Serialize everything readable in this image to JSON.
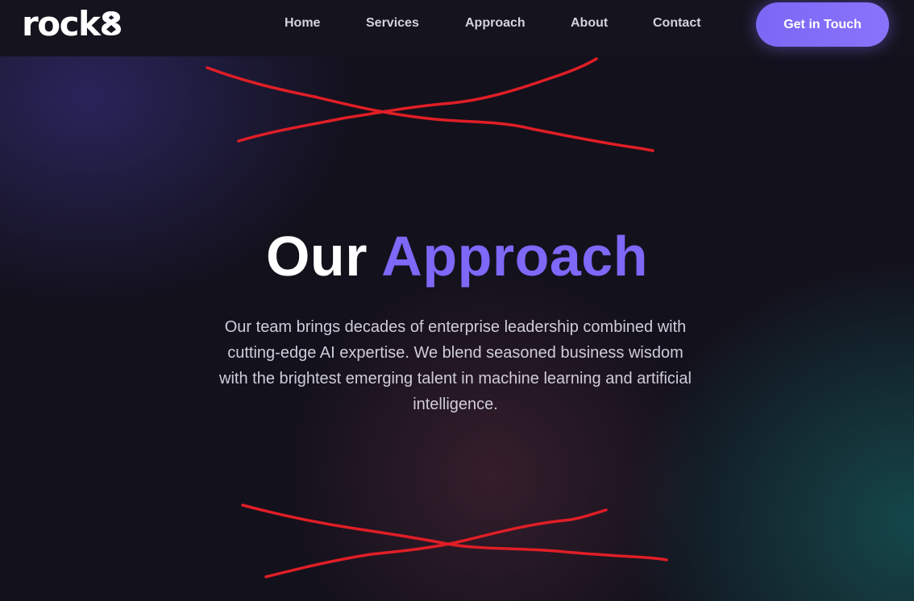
{
  "header": {
    "logo_text": "rock",
    "logo_mark_icon": "figure-eight-logo-icon",
    "nav": [
      {
        "label": "Home"
      },
      {
        "label": "Services"
      },
      {
        "label": "Approach"
      },
      {
        "label": "About"
      },
      {
        "label": "Contact"
      }
    ],
    "cta_label": "Get in Touch"
  },
  "hero": {
    "title_part1": "Our",
    "title_part2": "Approach",
    "subtitle": "Our team brings decades of enterprise leadership combined with cutting-edge AI expertise. We blend seasoned business wisdom with the brightest emerging talent in machine learning and artificial intelligence."
  },
  "colors": {
    "background": "#13111c",
    "accent": "#7d68f8",
    "annotation": "#e01e26"
  }
}
